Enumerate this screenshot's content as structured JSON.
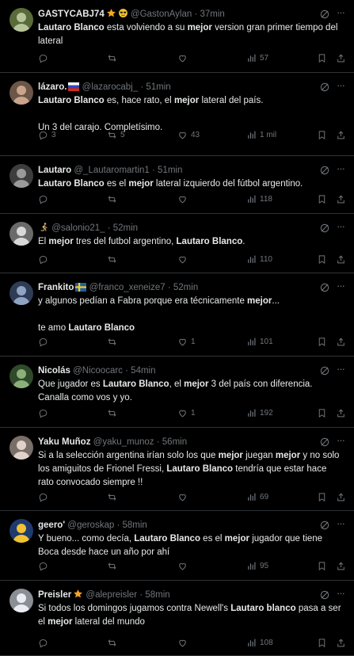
{
  "tweets": [
    {
      "name": "GASTYCABJ74",
      "badges": [
        "star",
        "sunglasses"
      ],
      "handle": "@GastonAylan",
      "time": "37min",
      "paragraphs": [
        [
          {
            "t": "Lautaro Blanco",
            "b": true
          },
          {
            "t": " esta volviendo a su "
          },
          {
            "t": "mejor",
            "b": true
          },
          {
            "t": " version gran primer tiempo del lateral"
          }
        ]
      ],
      "reply": "",
      "retweet": "",
      "like": "",
      "views": "57",
      "avatar": {
        "bg": "#5a6b3a",
        "fg": "#b7c49a"
      }
    },
    {
      "name": "lázaro.",
      "badges": [
        "flag-ru"
      ],
      "handle": "@lazarocabj_",
      "time": "51min",
      "paragraphs": [
        [
          {
            "t": "Lautaro Blanco",
            "b": true
          },
          {
            "t": " es, hace rato, el "
          },
          {
            "t": "mejor",
            "b": true
          },
          {
            "t": " lateral del país."
          }
        ],
        [
          {
            "t": "Un 3 del carajo. Completísimo."
          }
        ]
      ],
      "reply": "3",
      "retweet": "5",
      "like": "43",
      "views": "1 mil",
      "avatar": {
        "bg": "#6b5648",
        "fg": "#caa48c"
      }
    },
    {
      "name": "Lautaro",
      "badges": [],
      "handle": "@_Lautaromartin1",
      "time": "51min",
      "paragraphs": [
        [
          {
            "t": "Lautaro Blanco",
            "b": true
          },
          {
            "t": " es el "
          },
          {
            "t": "mejor",
            "b": true
          },
          {
            "t": " lateral izquierdo del fútbol argentino."
          }
        ]
      ],
      "reply": "",
      "retweet": "",
      "like": "",
      "views": "118",
      "avatar": {
        "bg": "#3d3d3d",
        "fg": "#9a9a9a"
      }
    },
    {
      "name": "",
      "badges": [
        "runner"
      ],
      "handle": "@salonio21_",
      "time": "52min",
      "paragraphs": [
        [
          {
            "t": "El "
          },
          {
            "t": "mejor",
            "b": true
          },
          {
            "t": " tres del futbol argentino, "
          },
          {
            "t": "Lautaro Blanco",
            "b": true
          },
          {
            "t": "."
          }
        ]
      ],
      "reply": "",
      "retweet": "",
      "like": "",
      "views": "110",
      "avatar": {
        "bg": "#6a6a6a",
        "fg": "#d8d8d8"
      }
    },
    {
      "name": "Frankito",
      "badges": [
        "flag-se"
      ],
      "handle": "@franco_xeneize7",
      "time": "52min",
      "paragraphs": [
        [
          {
            "t": "y algunos pedían a Fabra porque era técnicamente "
          },
          {
            "t": "mejor",
            "b": true
          },
          {
            "t": "..."
          }
        ],
        [
          {
            "t": "te amo "
          },
          {
            "t": "Lautaro Blanco",
            "b": true
          }
        ]
      ],
      "reply": "",
      "retweet": "",
      "like": "1",
      "views": "101",
      "avatar": {
        "bg": "#2e3d55",
        "fg": "#8fa3c2"
      }
    },
    {
      "name": "Nicolás",
      "badges": [],
      "handle": "@Nicoocarc",
      "time": "54min",
      "paragraphs": [
        [
          {
            "t": "Que jugador es "
          },
          {
            "t": "Lautaro Blanco",
            "b": true
          },
          {
            "t": ", el "
          },
          {
            "t": "mejor",
            "b": true
          },
          {
            "t": " 3 del país con diferencia. Canalla como vos y yo."
          }
        ]
      ],
      "reply": "",
      "retweet": "",
      "like": "1",
      "views": "192",
      "avatar": {
        "bg": "#2f4a2a",
        "fg": "#8cb07a"
      }
    },
    {
      "name": "Yaku Muñoz",
      "badges": [],
      "handle": "@yaku_munoz",
      "time": "56min",
      "paragraphs": [
        [
          {
            "t": "Si a la selección argentina irían solo los que "
          },
          {
            "t": "mejor",
            "b": true
          },
          {
            "t": " juegan "
          },
          {
            "t": "mejor",
            "b": true
          },
          {
            "t": " y no solo los amiguitos de Frionel Fressi, "
          },
          {
            "t": "Lautaro  Blanco",
            "b": true
          },
          {
            "t": " tendría que estar hace rato convocado siempre !!"
          }
        ]
      ],
      "reply": "",
      "retweet": "",
      "like": "",
      "views": "69",
      "avatar": {
        "bg": "#7a6e69",
        "fg": "#e0d2cb"
      }
    },
    {
      "name": "geero'",
      "badges": [],
      "handle": "@geroskap",
      "time": "58min",
      "paragraphs": [
        [
          {
            "t": "Y bueno... como decía, "
          },
          {
            "t": "Lautaro Blanco",
            "b": true
          },
          {
            "t": " es el "
          },
          {
            "t": "mejor",
            "b": true
          },
          {
            "t": " jugador que tiene Boca desde hace un año por ahí"
          }
        ]
      ],
      "reply": "",
      "retweet": "",
      "like": "",
      "views": "95",
      "avatar": {
        "bg": "#1f3a6e",
        "fg": "#f2c230"
      }
    },
    {
      "name": "Preisler",
      "badges": [
        "star"
      ],
      "handle": "@alepreisler",
      "time": "58min",
      "paragraphs": [
        [
          {
            "t": "Si todos los domingos jugamos contra Newell's "
          },
          {
            "t": "Lautaro blanco",
            "b": true
          },
          {
            "t": " pasa a ser el "
          },
          {
            "t": "mejor",
            "b": true
          },
          {
            "t": " lateral del mundo"
          }
        ]
      ],
      "reply": "",
      "retweet": "",
      "like": "",
      "views": "108",
      "avatar": {
        "bg": "#8a8f96",
        "fg": "#e9edf2"
      }
    }
  ],
  "colors": {
    "background": "#000000",
    "text": "#e7e9ea",
    "muted": "#71767b",
    "divider": "#2f3336",
    "star": "#f5a623"
  }
}
